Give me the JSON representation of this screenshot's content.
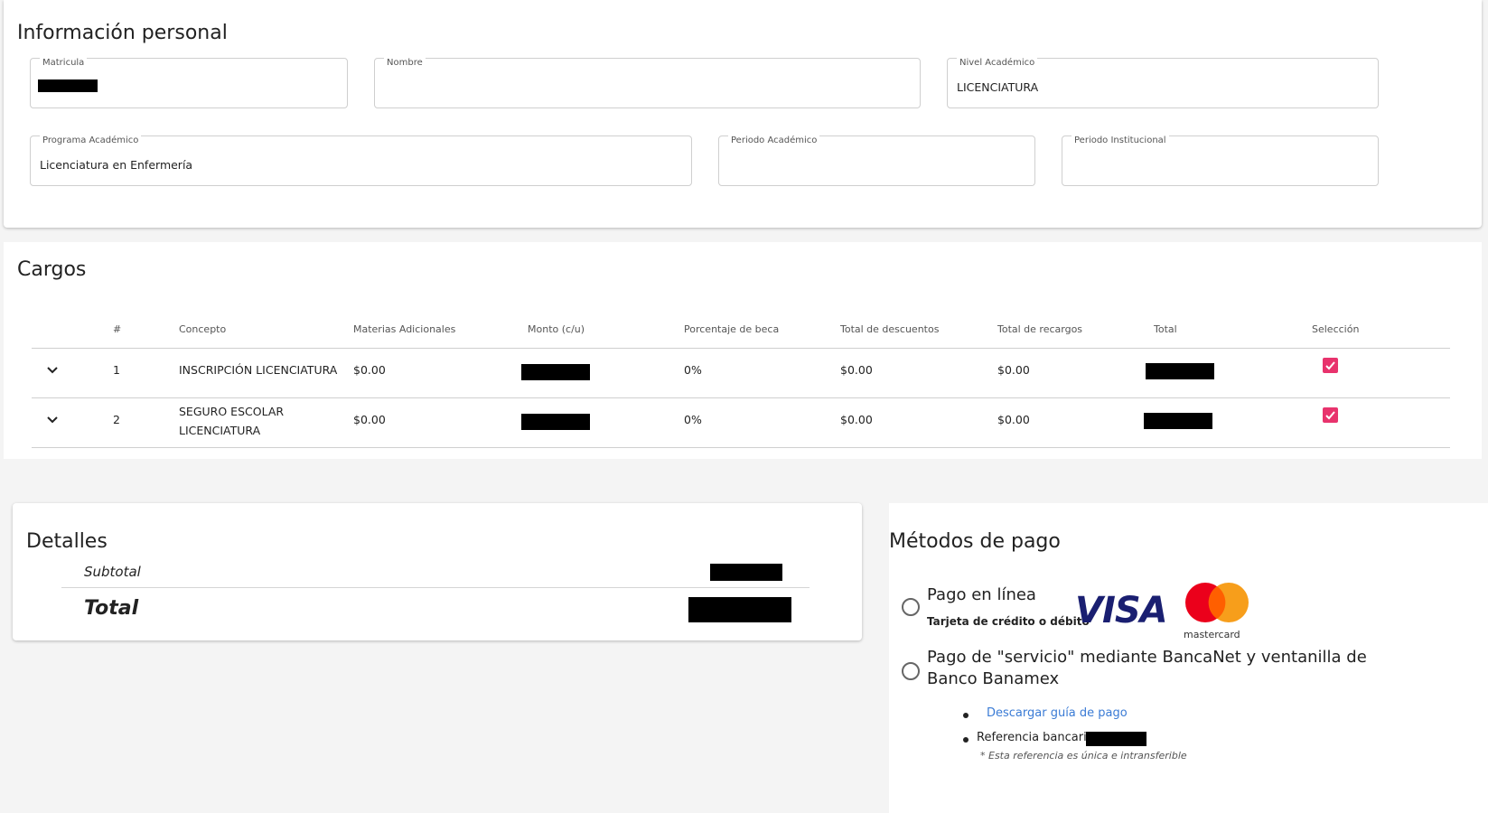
{
  "personal": {
    "title": "Información personal",
    "fields": {
      "matricula": {
        "label": "Matricula",
        "value": ""
      },
      "nombre": {
        "label": "Nombre",
        "value": ""
      },
      "nivel": {
        "label": "Nivel Académico",
        "value": "LICENCIATURA"
      },
      "programa": {
        "label": "Programa Académico",
        "value": "Licenciatura en Enfermería"
      },
      "periodo_academico": {
        "label": "Periodo Académico",
        "value": ""
      },
      "periodo_institucional": {
        "label": "Periodo Institucional",
        "value": ""
      }
    }
  },
  "charges": {
    "title": "Cargos",
    "headers": [
      "#",
      "Concepto",
      "Materias Adicionales",
      "Monto (c/u)",
      "Porcentaje de beca",
      "Total de descuentos",
      "Total de recargos",
      "Total",
      "Selección"
    ],
    "rows": [
      {
        "num": "1",
        "concept": "INSCRIPCIÓN LICENCIATURA",
        "extra": "$0.00",
        "percent": "0%",
        "discounts": "$0.00",
        "surcharges": "$0.00",
        "selected": true
      },
      {
        "num": "2",
        "concept": "SEGURO ESCOLAR LICENCIATURA",
        "extra": "$0.00",
        "percent": "0%",
        "discounts": "$0.00",
        "surcharges": "$0.00",
        "selected": true
      }
    ]
  },
  "details": {
    "title": "Detalles",
    "subtotal_label": "Subtotal",
    "total_label": "Total"
  },
  "payment": {
    "title": "Métodos de pago",
    "online": {
      "title": "Pago en línea",
      "subtitle": "Tarjeta de crédito o débito",
      "visa": "VISA",
      "mastercard": "mastercard"
    },
    "bank": {
      "title": "Pago de \"servicio\" mediante BancaNet y ventanilla de Banco Banamex",
      "download_link": "Descargar guía de pago",
      "reference_label": "Referencia bancaria:",
      "note": "* Esta referencia es única e intransferible"
    }
  },
  "colors": {
    "accent": "#e8336d",
    "link": "#3a7bd5",
    "visa": "#1a1f71"
  }
}
